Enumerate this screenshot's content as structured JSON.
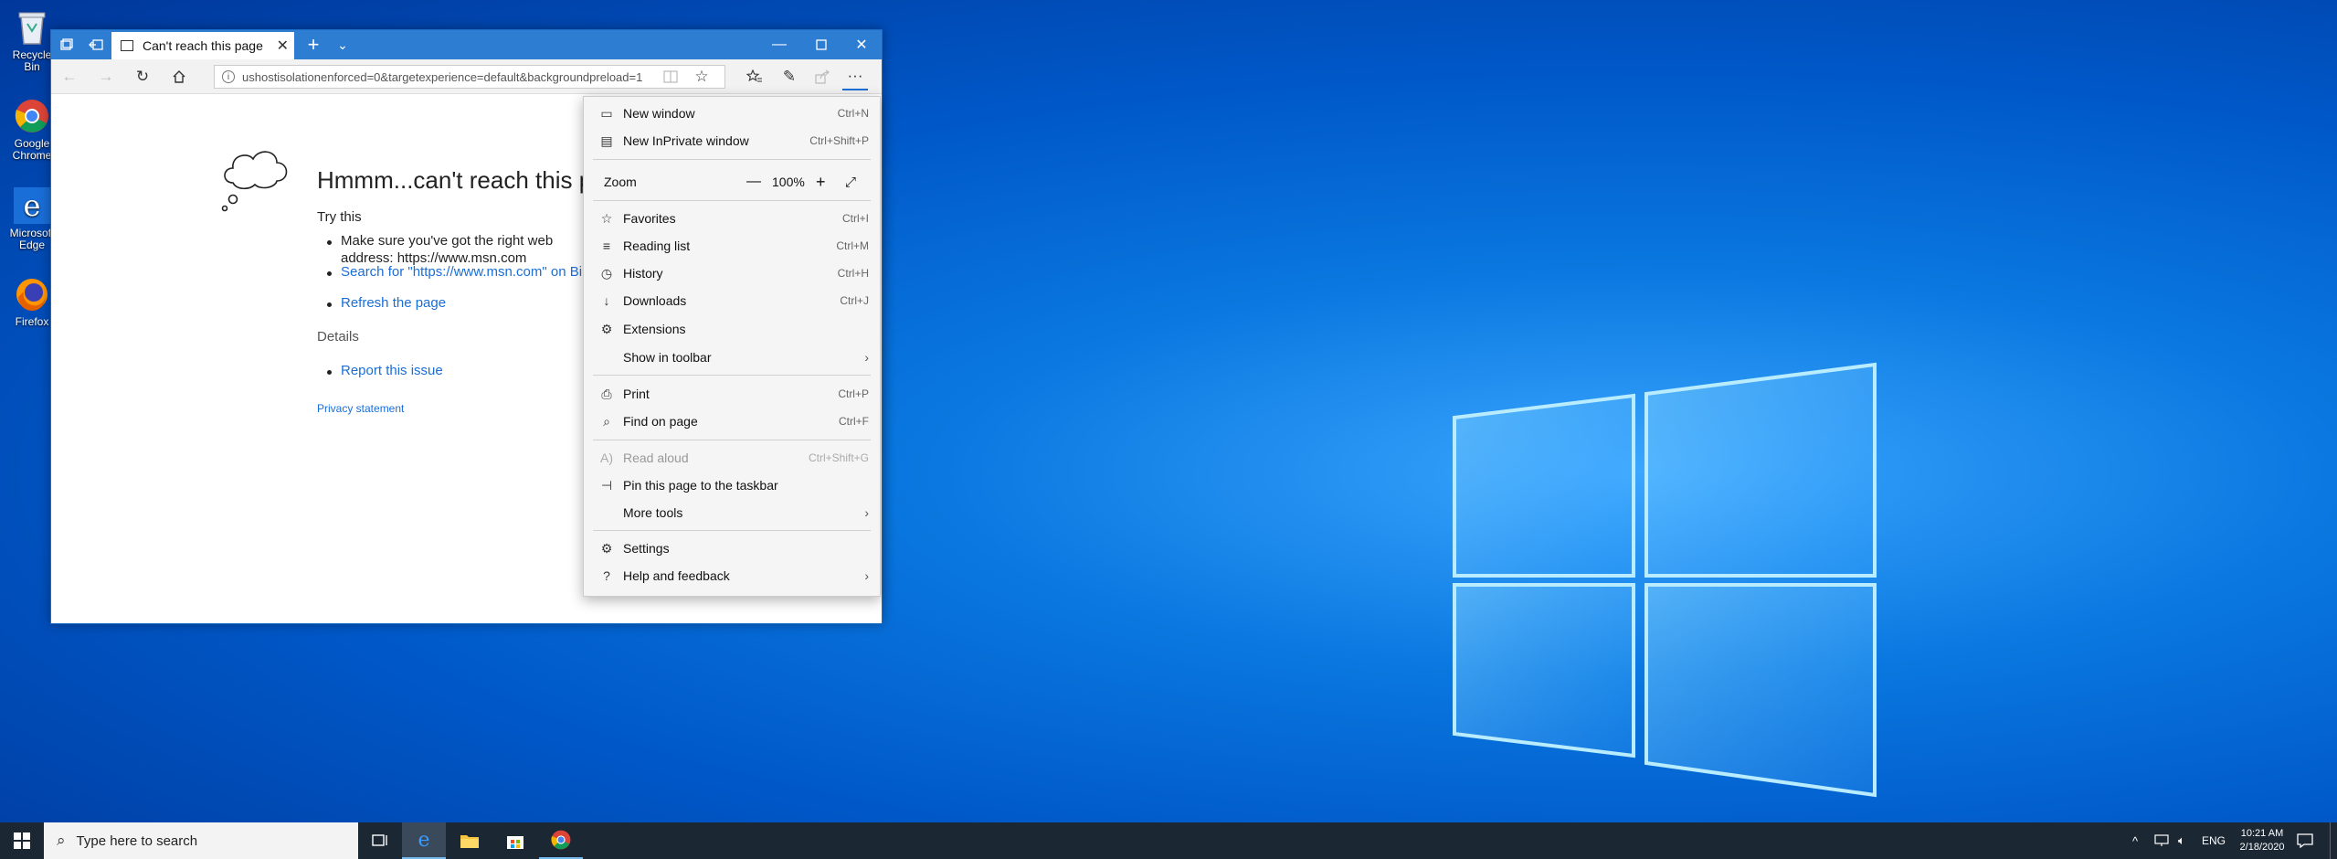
{
  "desktop": {
    "icons": [
      {
        "label": "Recycle Bin",
        "icon": "recycle-bin-icon"
      },
      {
        "label": "Google Chrome",
        "icon": "chrome-icon"
      },
      {
        "label": "Microsoft Edge",
        "icon": "edge-icon"
      },
      {
        "label": "Firefox",
        "icon": "firefox-icon"
      }
    ]
  },
  "browser": {
    "tab_title": "Can't reach this page",
    "address": "ushostisolationenforced=0&targetexperience=default&backgroundpreload=1"
  },
  "error_page": {
    "title": "Hmmm...can't reach this page",
    "try_this": "Try this",
    "bullet1_line1": "Make sure you've got the right web",
    "bullet1_line2": "address: https://www.msn.com",
    "search_link": "Search for \"https://www.msn.com\" on Bing",
    "refresh_link": "Refresh the page",
    "details": "Details",
    "report_link": "Report this issue",
    "privacy_link": "Privacy statement"
  },
  "menu": {
    "new_window": {
      "label": "New window",
      "key": "Ctrl+N"
    },
    "new_inprivate": {
      "label": "New InPrivate window",
      "key": "Ctrl+Shift+P"
    },
    "zoom": {
      "label": "Zoom",
      "value": "100%"
    },
    "favorites": {
      "label": "Favorites",
      "key": "Ctrl+I"
    },
    "reading_list": {
      "label": "Reading list",
      "key": "Ctrl+M"
    },
    "history": {
      "label": "History",
      "key": "Ctrl+H"
    },
    "downloads": {
      "label": "Downloads",
      "key": "Ctrl+J"
    },
    "extensions": {
      "label": "Extensions"
    },
    "show_in_toolbar": {
      "label": "Show in toolbar"
    },
    "print": {
      "label": "Print",
      "key": "Ctrl+P"
    },
    "find_on_page": {
      "label": "Find on page",
      "key": "Ctrl+F"
    },
    "read_aloud": {
      "label": "Read aloud",
      "key": "Ctrl+Shift+G"
    },
    "pin_taskbar": {
      "label": "Pin this page to the taskbar"
    },
    "more_tools": {
      "label": "More tools"
    },
    "settings": {
      "label": "Settings"
    },
    "help": {
      "label": "Help and feedback"
    }
  },
  "taskbar": {
    "search_placeholder": "Type here to search",
    "language": "ENG",
    "time": "10:21 AM",
    "date": "2/18/2020"
  },
  "colors": {
    "titlebar": "#2d7dd2",
    "link": "#1a6ed8",
    "taskbar": "#1b2733"
  }
}
